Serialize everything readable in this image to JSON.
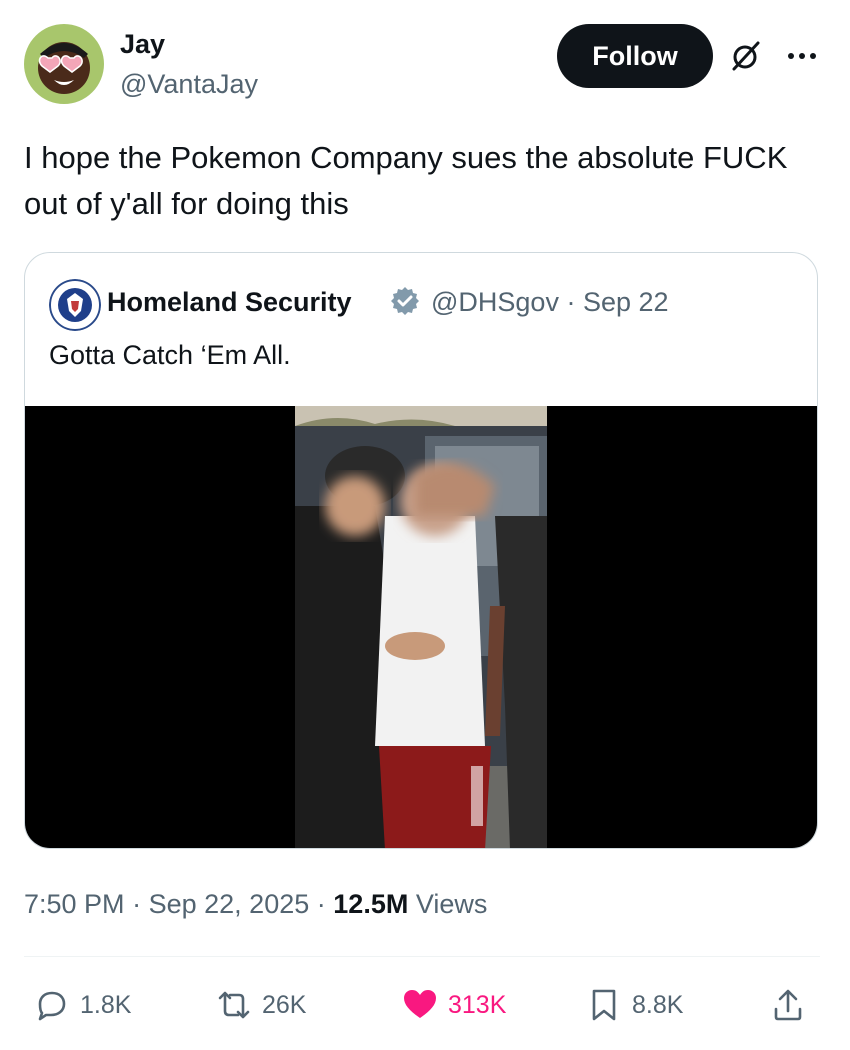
{
  "author": {
    "name": "Jay",
    "handle": "@VantaJay",
    "avatar_icon": "avatar-heart-sunglasses-icon"
  },
  "header_actions": {
    "follow_label": "Follow",
    "grok_icon": "grok-icon",
    "more_icon": "more-icon"
  },
  "tweet": {
    "text": "I hope the Pokemon Company sues the absolute FUCK out of y'all for doing this"
  },
  "quote": {
    "name": "Homeland Security",
    "verified_icon": "verified-badge-icon",
    "handle": "@DHSgov",
    "separator": "·",
    "date": "Sep 22",
    "text": "Gotta Catch ‘Em All.",
    "media_icon": "video-thumbnail"
  },
  "meta": {
    "time": "7:50 PM",
    "sep1": "·",
    "date": "Sep 22, 2025",
    "sep2": "·",
    "views_count": "12.5M",
    "views_label": "Views"
  },
  "actions": {
    "replies": "1.8K",
    "reposts": "26K",
    "likes": "313K",
    "bookmarks": "8.8K"
  },
  "colors": {
    "text_primary": "#0f1419",
    "text_secondary": "#536471",
    "like_pink": "#f91880",
    "follow_bg": "#0f1419",
    "verified_gray": "#829aab",
    "border": "#cfd9de"
  }
}
